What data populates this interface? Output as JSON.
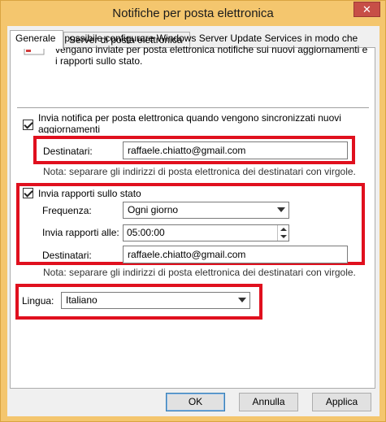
{
  "window": {
    "title": "Notifiche per posta elettronica",
    "close_label": "✕"
  },
  "tabs": [
    {
      "label": "Generale",
      "active": true
    },
    {
      "label": "Server di posta elettronica",
      "active": false
    }
  ],
  "info": {
    "icon": "envelope-icon",
    "text": "È possibile configurare Windows Server Update Services in modo che vengano inviate per posta elettronica notifiche sui nuovi aggiornamenti e i rapporti sullo stato."
  },
  "sync_notify": {
    "checked": true,
    "label": "Invia notifica per posta elettronica quando vengono sincronizzati nuovi aggiornamenti",
    "recipients_label": "Destinatari:",
    "recipients_value": "raffaele.chiatto@gmail.com",
    "note": "Nota: separare gli indirizzi di posta elettronica dei destinatari con virgole."
  },
  "status_reports": {
    "checked": true,
    "label": "Invia rapporti sullo stato",
    "frequency_label": "Frequenza:",
    "frequency_value": "Ogni giorno",
    "send_at_label": "Invia rapporti alle:",
    "send_at_value": "05:00:00",
    "recipients_label": "Destinatari:",
    "recipients_value": "raffaele.chiatto@gmail.com",
    "note": "Nota: separare gli indirizzi di posta elettronica dei destinatari con virgole."
  },
  "language": {
    "label": "Lingua:",
    "value": "Italiano"
  },
  "buttons": {
    "ok": "OK",
    "cancel": "Annulla",
    "apply": "Applica"
  },
  "colors": {
    "highlight": "#e0101e",
    "titlebar": "#f4c66e",
    "close": "#c74f47"
  }
}
